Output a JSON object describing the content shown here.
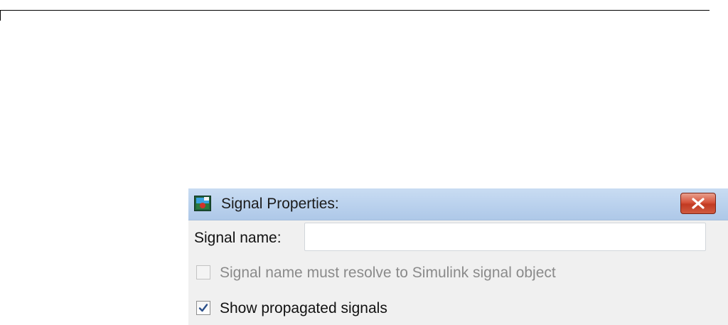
{
  "dialog": {
    "title": "Signal Properties:",
    "app_icon": "simulink-window-icon",
    "close_icon": "close-icon",
    "signal_name": {
      "label": "Signal name:",
      "value": "",
      "placeholder": ""
    },
    "resolve_checkbox": {
      "label": "Signal name must resolve to Simulink signal object",
      "checked": false,
      "enabled": false
    },
    "propagate_checkbox": {
      "label": "Show propagated signals",
      "checked": true,
      "enabled": true
    }
  },
  "colors": {
    "titlebar": "#bcd3ee",
    "close_button": "#d6533b",
    "dialog_background": "#f0f0f0",
    "check_mark": "#2b4f8a",
    "disabled_text": "#8a8a8a"
  }
}
